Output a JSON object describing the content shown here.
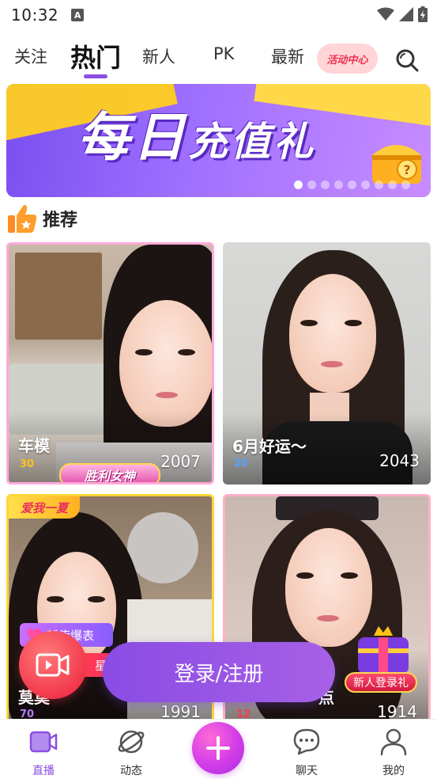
{
  "status_bar": {
    "time": "10:32",
    "notification_letter": "A"
  },
  "top_tabs": {
    "tabs": [
      {
        "label": "关注"
      },
      {
        "label": "热门",
        "active": true
      },
      {
        "label": "新人"
      },
      {
        "label": "PK"
      },
      {
        "label": "最新"
      }
    ],
    "activity_center": "活动中心"
  },
  "banner": {
    "text_big": "每日",
    "text_small": "充值礼",
    "page_count": 9,
    "active_page": 1
  },
  "section": {
    "title": "推荐"
  },
  "cards": [
    {
      "name": "车模",
      "level": "30",
      "level_color": "#ffc21a",
      "count": "2007",
      "badge": "胜利女神"
    },
    {
      "name": "6月好运～",
      "level": "26",
      "level_color": "#5aa0ff",
      "count": "2043"
    },
    {
      "name": "莫莫",
      "level": "70",
      "level_color": "#b57cff",
      "count": "1991",
      "corner_badge": "爱我一夏",
      "tag_hot": "新传爆表",
      "tag_star": "星"
    },
    {
      "name": "点",
      "level": "12",
      "level_color": "#ff3a4a",
      "count": "1914",
      "tag_newbie": "新人登录礼"
    }
  ],
  "login_button": "登录/注册",
  "bottom_nav": [
    {
      "label": "直播",
      "icon": "video-icon",
      "active": true
    },
    {
      "label": "动态",
      "icon": "planet-icon"
    },
    {
      "label": "",
      "icon": "plus-icon"
    },
    {
      "label": "聊天",
      "icon": "chat-icon"
    },
    {
      "label": "我的",
      "icon": "profile-icon"
    }
  ],
  "colors": {
    "accent": "#8a4ee0",
    "activity_text": "#f0304f",
    "activity_bg": "#ffd5d7"
  }
}
